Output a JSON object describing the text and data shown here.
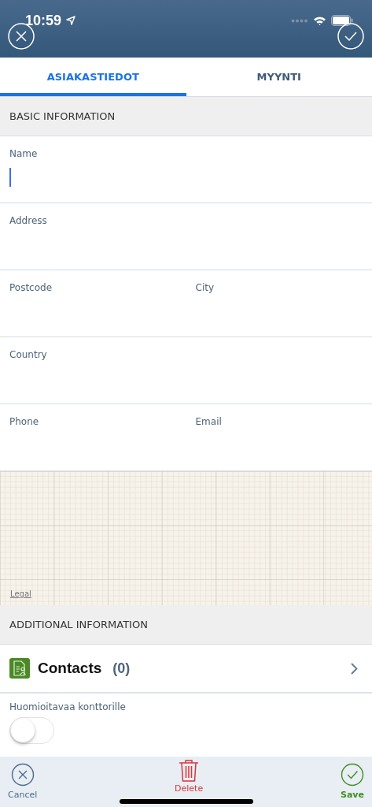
{
  "status_bar": {
    "time": "10:59"
  },
  "tabs": [
    {
      "label": "ASIAKASTIEDOT",
      "selected": true
    },
    {
      "label": "MYYNTI",
      "selected": false
    }
  ],
  "basic_section": {
    "title": "BASIC INFORMATION"
  },
  "form_rows": [
    {
      "fields": [
        {
          "label": "Name",
          "focused": true
        }
      ]
    },
    {
      "fields": [
        {
          "label": "Address",
          "focused": false
        }
      ]
    },
    {
      "fields": [
        {
          "label": "Postcode",
          "focused": false
        },
        {
          "label": "City",
          "focused": false
        }
      ]
    },
    {
      "fields": [
        {
          "label": "Country",
          "focused": false
        }
      ]
    },
    {
      "fields": [
        {
          "label": "Phone",
          "focused": false
        },
        {
          "label": "Email",
          "focused": false
        }
      ]
    }
  ],
  "map": {
    "kind": "picture",
    "legal_link": "Legal"
  },
  "additional_section": {
    "title": "ADDITIONAL INFORMATION"
  },
  "contacts": {
    "label": "Contacts",
    "count": "(0)"
  },
  "office_note": {
    "label": "Huomioitavaa konttorille",
    "on": false
  },
  "bottom_bar": [
    {
      "kind": "cancel",
      "label": "Cancel"
    },
    {
      "kind": "delete",
      "label": "Delete"
    },
    {
      "kind": "save",
      "label": "Save"
    }
  ]
}
